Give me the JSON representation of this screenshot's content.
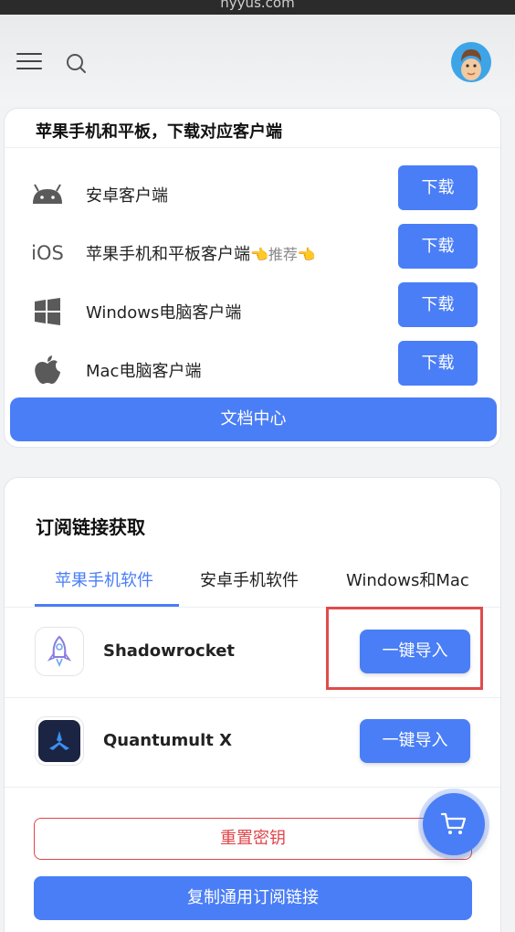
{
  "browser": {
    "url_fragment": "hyyus.com"
  },
  "header": {
    "menu_icon": "hamburger-menu-icon",
    "search_icon": "search-icon",
    "avatar_icon": "memoji-avatar"
  },
  "download_card": {
    "title": "苹果手机和平板，下载对应客户端",
    "clients": [
      {
        "icon": "android-icon",
        "label": "安卓客户端",
        "button": "下载"
      },
      {
        "icon": "ios-text-icon",
        "icon_text": "iOS",
        "label": "苹果手机和平板客户端",
        "recommend": "👈推荐👈",
        "button": "下载"
      },
      {
        "icon": "windows-icon",
        "label": "Windows电脑客户端",
        "button": "下载"
      },
      {
        "icon": "apple-icon",
        "label": "Mac电脑客户端",
        "button": "下载"
      }
    ],
    "docs_button": "文档中心"
  },
  "subscription_card": {
    "title": "订阅链接获取",
    "tabs": [
      {
        "label": "苹果手机软件",
        "active": true
      },
      {
        "label": "安卓手机软件",
        "active": false
      },
      {
        "label": "Windows和Mac",
        "active": false
      }
    ],
    "apps": [
      {
        "name": "Shadowrocket",
        "button": "一键导入",
        "icon": "rocket-icon"
      },
      {
        "name": "Quantumult X",
        "button": "一键导入",
        "icon": "quantumult-icon"
      }
    ],
    "reset_button": "重置密钥",
    "copy_button": "复制通用订阅链接"
  },
  "floating": {
    "cart_icon": "cart-icon"
  },
  "colors": {
    "accent": "#4a7ef6",
    "danger": "#e0454a",
    "highlight": "#e04b4b"
  }
}
